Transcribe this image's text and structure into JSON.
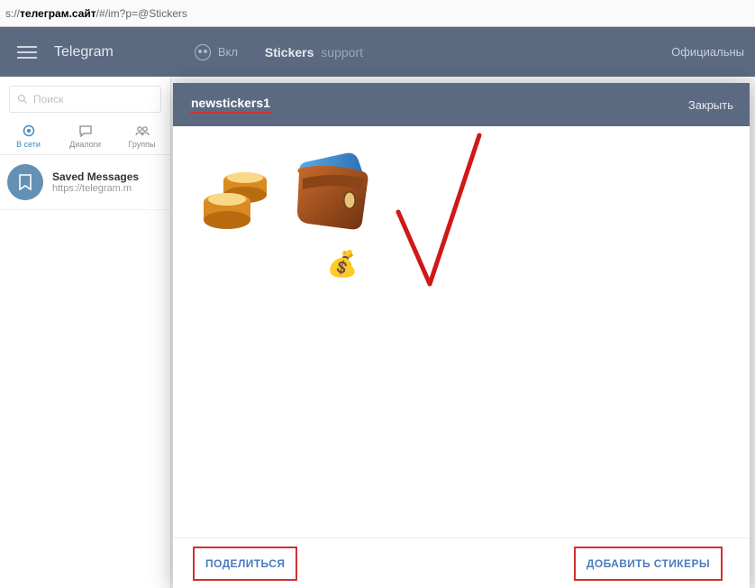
{
  "addressbar": {
    "prefix": "s://",
    "host": "телеграм.сайт",
    "path": "/#/im?p=@Stickers"
  },
  "topbar": {
    "brand": "Telegram",
    "incognito_label": "Вкл",
    "bot_name": "Stickers",
    "bot_suffix": "support",
    "right_link": "Официальны"
  },
  "search": {
    "placeholder": "Поиск"
  },
  "tabs": [
    {
      "label": "В сети",
      "active": true
    },
    {
      "label": "Диалоги",
      "active": false
    },
    {
      "label": "Группы",
      "active": false
    }
  ],
  "conversation": {
    "title": "Saved Messages",
    "subtitle": "https://telegram.m"
  },
  "modal": {
    "pack_name": "newstickers1",
    "close_label": "Закрыть",
    "share_label": "ПОДЕЛИТЬСЯ",
    "add_label": "ДОБАВИТЬ СТИКЕРЫ",
    "stickers": [
      {
        "name": "coins"
      },
      {
        "name": "wallet"
      },
      {
        "name": "moneybag"
      }
    ]
  }
}
